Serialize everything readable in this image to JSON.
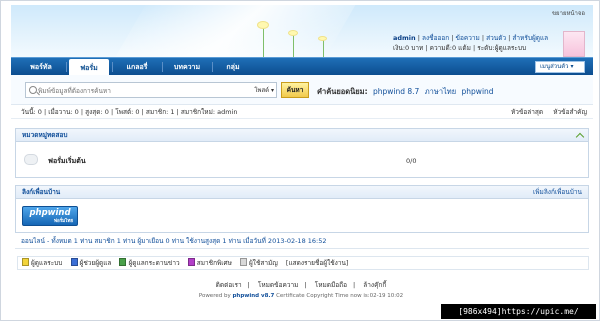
{
  "header": {
    "expand_link": "ขยายหน้าจอ",
    "user": {
      "name": "admin",
      "logout": "ลงชื่อออก",
      "messages": "ข้อความ",
      "private": "ส่วนตัว",
      "admin_link": "สำหรับผู้ดูแล",
      "money": "เงิน:0 บาท",
      "credits": "ความดี:0 แต้ม",
      "level": "ระดับ:ผู้ดูแลระบบ"
    }
  },
  "nav": {
    "items": [
      "พอร์ทัล",
      "ฟอรั่ม",
      "แกลอรี่",
      "บทความ",
      "กลุ่ม"
    ],
    "active": "ฟอรั่ม",
    "quick_menu": "เมนูส่วนตัว"
  },
  "search": {
    "placeholder": "พิมพ์ข้อมูลที่ต้องการค้นหา",
    "type": "โพสต์",
    "button": "ค้นหา",
    "hotwords_label": "คำค้นยอดนิยม:",
    "hotwords": [
      "phpwind 8.7",
      "ภาษาไทย",
      "phpwind"
    ]
  },
  "stats": {
    "today": "วันนี้: 0",
    "yesterday": "เมื่อวาน: 0",
    "max": "สูงสุด: 0",
    "posts": "โพสต์: 0",
    "members": "สมาชิก: 1",
    "new_member": "สมาชิกใหม่: admin",
    "latest_topics": "หัวข้อล่าสุด",
    "top_topics": "หัวข้อสำคัญ"
  },
  "category": {
    "title": "หมวดหมู่ทดสอบ",
    "forum_name": "ฟอรั่มเริ่มต้น",
    "forum_count": "0/0"
  },
  "links": {
    "title": "ลิงก์เพื่อนบ้าน",
    "add": "เพิ่มลิงก์เพื่อนบ้าน",
    "logo_text": "phpwind",
    "logo_sub": "ฟอรั่มไทย"
  },
  "online": {
    "text": "ออนไลน์ - ทั้งหมด 1 ท่าน สมาชิก 1 ท่าน ผู้มาเยือน 0 ท่าน ใช้งานสูงสุด 1 ท่าน เมื่อวันที่ 2013-02-18 16:52"
  },
  "legend": {
    "items": [
      {
        "label": "ผู้ดูแลระบบ",
        "color": "#f2d43b"
      },
      {
        "label": "ผู้ช่วยผู้ดูแล",
        "color": "#3b6fd6"
      },
      {
        "label": "ผู้ดูแลกระดานข่าว",
        "color": "#4aa04a"
      },
      {
        "label": "สมาชิกพิเศษ",
        "color": "#b23fc8"
      },
      {
        "label": "ผู้ใช้สามัญ",
        "color": "#d9d9d9"
      }
    ],
    "toggle": "[แสดงรายชื่อผู้ใช้งาน]"
  },
  "footer": {
    "links": [
      "ติดต่อเรา",
      "โหมดข้อความ",
      "โหมดมือถือ",
      "ล้างคุ๊กกี้"
    ],
    "powered_prefix": "Powered by",
    "powered_brand": "phpwind v8.7",
    "powered_suffix": "Certificate Copyright Time now is:02-19 10:02"
  },
  "watermark": "[986x494]https://upic.me/"
}
